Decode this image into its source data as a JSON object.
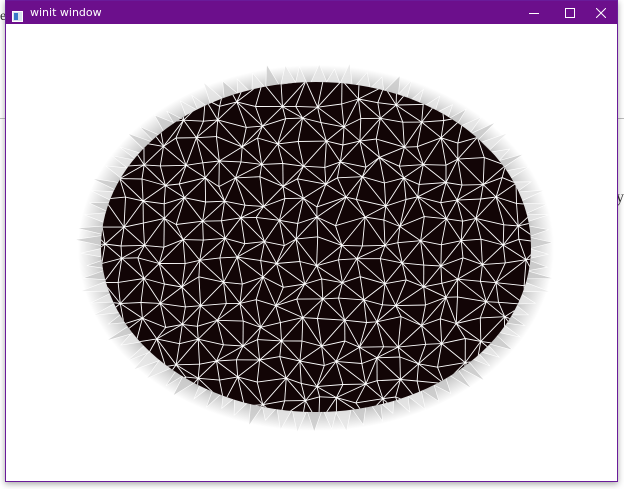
{
  "window": {
    "title": "winit window",
    "accent_color": "#6c0f8c",
    "icons": [
      "app-icon",
      "minimize-icon",
      "maximize-icon",
      "close-icon"
    ]
  },
  "scene": {
    "shape": "ellipse",
    "fill_color": "#120506",
    "edge_color": "#ffffff",
    "grid_spacing": 20
  }
}
